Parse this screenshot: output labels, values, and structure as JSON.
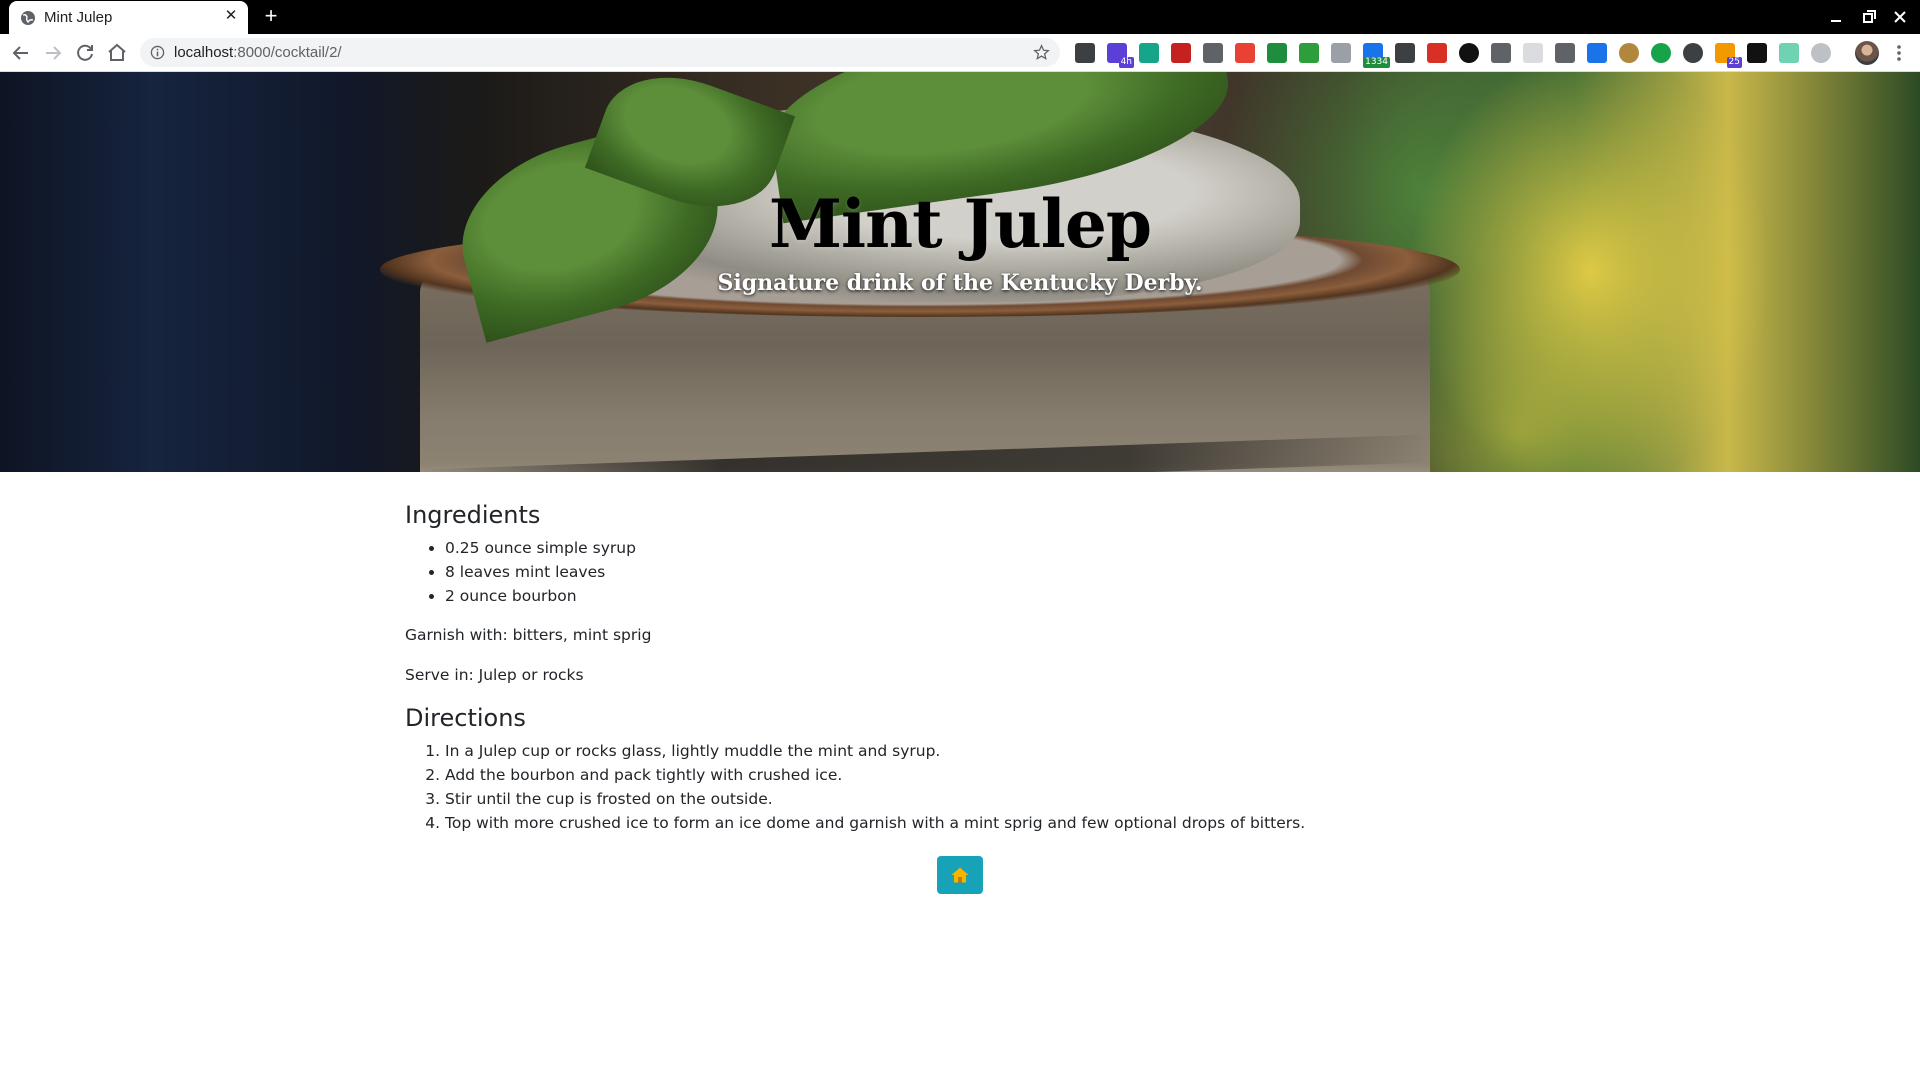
{
  "browser": {
    "tab_title": "Mint Julep",
    "url_host": "localhost",
    "url_rest": ":8000/cocktail/2/",
    "extensions": [
      {
        "icon": "notion-icon",
        "badge": ""
      },
      {
        "icon": "calendar-extension-icon",
        "badge": "4h"
      },
      {
        "icon": "tab-manager-icon",
        "badge": ""
      },
      {
        "icon": "gmail-icon",
        "badge": ""
      },
      {
        "icon": "cube-icon",
        "badge": ""
      },
      {
        "icon": "color-wheel-icon",
        "badge": ""
      },
      {
        "icon": "rainbow-icon",
        "badge": ""
      },
      {
        "icon": "evernote-icon",
        "badge": ""
      },
      {
        "icon": "printer-icon",
        "badge": ""
      },
      {
        "icon": "counter-icon",
        "badge": "1334"
      },
      {
        "icon": "shield-icon",
        "badge": ""
      },
      {
        "icon": "pocket-icon",
        "badge": ""
      },
      {
        "icon": "record-icon",
        "badge": ""
      },
      {
        "icon": "paint-roller-icon",
        "badge": ""
      },
      {
        "icon": "blank-extension-icon",
        "badge": ""
      },
      {
        "icon": "vuejs-icon",
        "badge": ""
      },
      {
        "icon": "highlighter-icon",
        "badge": ""
      },
      {
        "icon": "cookie-icon",
        "badge": ""
      },
      {
        "icon": "speech-bubble-icon",
        "badge": ""
      },
      {
        "icon": "dark-mode-icon",
        "badge": ""
      },
      {
        "icon": "rss-icon",
        "badge": "25"
      },
      {
        "icon": "gnome-icon",
        "badge": ""
      },
      {
        "icon": "wave-icon",
        "badge": ""
      },
      {
        "icon": "clock-icon",
        "badge": ""
      }
    ]
  },
  "hero": {
    "title": "Mint Julep",
    "subtitle": "Signature drink of the Kentucky Derby."
  },
  "ingredients": {
    "heading": "Ingredients",
    "items": [
      "0.25 ounce simple syrup",
      "8 leaves mint leaves",
      "2 ounce bourbon"
    ],
    "garnish": "Garnish with: bitters, mint sprig",
    "serve": "Serve in: Julep or rocks"
  },
  "directions": {
    "heading": "Directions",
    "steps": [
      "In a Julep cup or rocks glass, lightly muddle the mint and syrup.",
      "Add the bourbon and pack tightly with crushed ice.",
      "Stir until the cup is frosted on the outside.",
      "Top with more crushed ice to form an ice dome and garnish with a mint sprig and few optional drops of bitters."
    ]
  },
  "colors": {
    "home_button": "#17a2b8",
    "home_icon": "#f5b400"
  }
}
